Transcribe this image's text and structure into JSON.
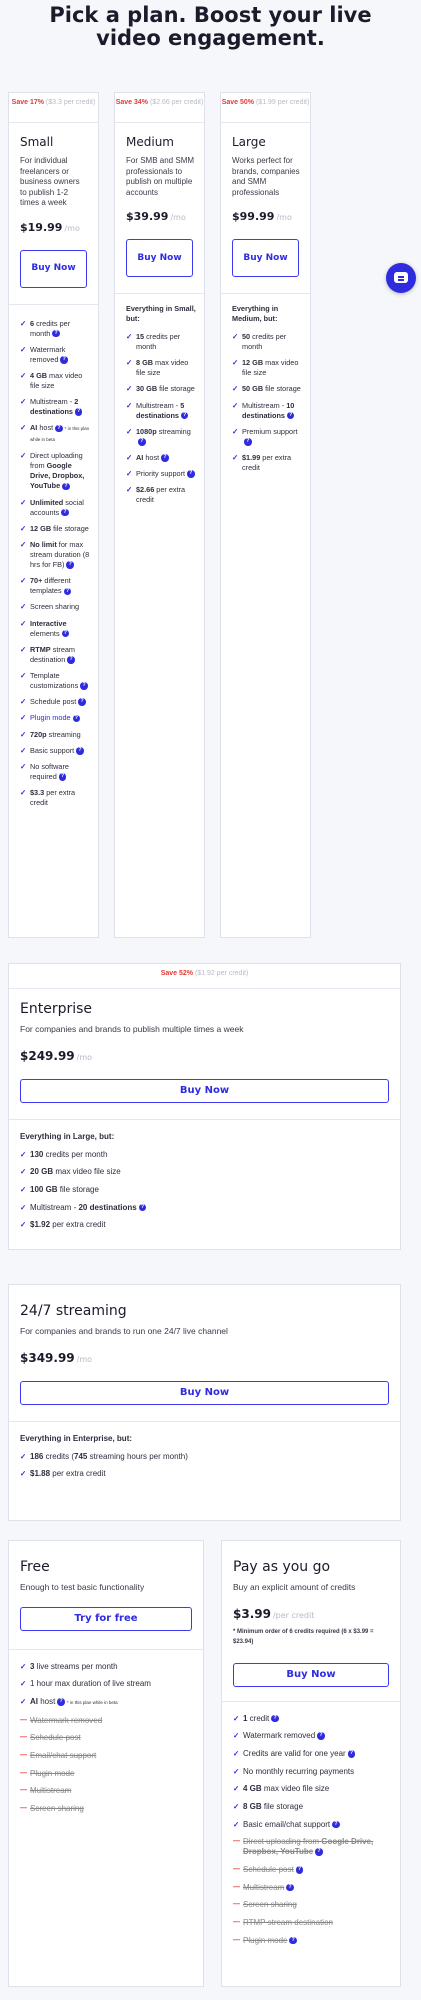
{
  "hero_title": "Pick a plan. Boost your live video engagement.",
  "plans": [
    {
      "id": "small",
      "save_pct": "Save 17%",
      "save_note": "($3.3 per credit)",
      "title": "Small",
      "desc": "For individual freelancers or business owners to publish 1-2 times a week",
      "price": "$19.99",
      "per": "/mo",
      "button": "Buy Now",
      "lead": "",
      "features": [
        {
          "bold": "6",
          "text": " credits per month",
          "help": true
        },
        {
          "text": "Watermark removed",
          "help": true
        },
        {
          "bold": "4 GB",
          "text": " max video file size"
        },
        {
          "text": "Multistream - ",
          "bold2": "2 destinations",
          "help": true
        },
        {
          "bold": "AI",
          "text": " host",
          "help": true,
          "beta": "* in this plan while in beta"
        },
        {
          "text": "Direct uploading from ",
          "bold2": "Google Drive, Dropbox, YouTube",
          "help": true
        },
        {
          "bold": "Unlimited",
          "text": " social accounts",
          "help": true
        },
        {
          "bold": "12 GB",
          "text": " file storage"
        },
        {
          "bold": "No limit",
          "text": " for max stream duration (8 hrs for FB)",
          "help": true
        },
        {
          "bold": "70+",
          "text": " different templates",
          "help": true
        },
        {
          "text": "Screen sharing"
        },
        {
          "bold": "Interactive",
          "text": " elements",
          "help": true
        },
        {
          "bold": "RTMP",
          "text": " stream destination",
          "help": true
        },
        {
          "text": "Template customizations",
          "help": true
        },
        {
          "text": "Schedule post",
          "help": true
        },
        {
          "text": "Plugin mode",
          "help": true,
          "plugin": true
        },
        {
          "bold": "720p",
          "text": " streaming"
        },
        {
          "text": "Basic support",
          "help": true
        },
        {
          "text": "No software required",
          "help": true
        },
        {
          "bold": "$3.3",
          "text": " per extra credit"
        }
      ]
    },
    {
      "id": "medium",
      "save_pct": "Save 34%",
      "save_note": "($2.66 per credit)",
      "title": "Medium",
      "desc": "For SMB and SMM professionals to publish on multiple accounts",
      "price": "$39.99",
      "per": "/mo",
      "button": "Buy Now",
      "lead": "Everything in Small, but:",
      "features": [
        {
          "bold": "15",
          "text": " credits per month"
        },
        {
          "bold": "8 GB",
          "text": " max video file size"
        },
        {
          "bold": "30 GB",
          "text": " file storage"
        },
        {
          "text": "Multistream - ",
          "bold2": "5 destinations",
          "help": true
        },
        {
          "bold": "1080p",
          "text": " streaming",
          "help": true
        },
        {
          "bold": "AI",
          "text": " host",
          "help": true
        },
        {
          "text": "Priority support",
          "help": true
        },
        {
          "bold": "$2.66",
          "text": " per extra credit"
        }
      ]
    },
    {
      "id": "large",
      "save_pct": "Save 50%",
      "save_note": "($1.99 per credit)",
      "title": "Large",
      "desc": "Works perfect for brands, companies and SMM professionals",
      "price": "$99.99",
      "per": "/mo",
      "button": "Buy Now",
      "lead": "Everything in Medium, but:",
      "features": [
        {
          "bold": "50",
          "text": " credits per month"
        },
        {
          "bold": "12 GB",
          "text": " max video file size"
        },
        {
          "bold": "50 GB",
          "text": " file storage"
        },
        {
          "text": "Multistream - ",
          "bold2": "10 destinations",
          "help": true
        },
        {
          "text": "Premium support",
          "help": true
        },
        {
          "bold": "$1.99",
          "text": " per extra credit"
        }
      ]
    }
  ],
  "enterprise": {
    "save_pct": "Save 52%",
    "save_note": "($1.92 per credit)",
    "title": "Enterprise",
    "desc": "For companies and brands to publish multiple times a week",
    "price": "$249.99",
    "per": "/mo",
    "button": "Buy Now",
    "lead": "Everything in Large, but:",
    "features": [
      {
        "bold": "130",
        "text": " credits per month"
      },
      {
        "bold": "20 GB",
        "text": " max video file size"
      },
      {
        "bold": "100 GB",
        "text": " file storage"
      },
      {
        "text": "Multistream - ",
        "bold2": "20 destinations",
        "help": true
      },
      {
        "bold": "$1.92",
        "text": " per extra credit"
      }
    ]
  },
  "streaming": {
    "title": "24/7 streaming",
    "desc": "For companies and brands to run one 24/7 live channel",
    "price": "$349.99",
    "per": "/mo",
    "button": "Buy Now",
    "lead": "Everything in Enterprise, but:",
    "features": [
      {
        "bold": "186",
        "text": " credits (",
        "bold2": "745",
        "text2": " streaming hours per month)"
      },
      {
        "bold": "$1.88",
        "text": " per extra credit"
      }
    ]
  },
  "free": {
    "title": "Free",
    "desc": "Enough to test basic functionality",
    "button": "Try for free",
    "features": [
      {
        "bold": "3",
        "text": " live streams per month"
      },
      {
        "text": "1 hour max duration of live stream"
      },
      {
        "bold": "AI",
        "text": " host",
        "help": true,
        "beta": "* in this plan while in beta"
      },
      {
        "text": "Watermark removed",
        "no": true
      },
      {
        "text": "Schedule post",
        "no": true
      },
      {
        "text": "Email/chat support",
        "no": true
      },
      {
        "text": "Plugin mode",
        "no": true
      },
      {
        "text": "Multistream",
        "no": true
      },
      {
        "text": "Screen sharing",
        "no": true
      }
    ]
  },
  "payg": {
    "title": "Pay as you go",
    "desc": "Buy an explicit amount of credits",
    "price": "$3.99",
    "per": "/per credit",
    "min_note": "* Minimum order of 6 credits required (6 x $3.99 = $23.94)",
    "button": "Buy Now",
    "features": [
      {
        "bold": "1",
        "text": " credit",
        "help": true
      },
      {
        "text": "Watermark removed",
        "help": true
      },
      {
        "text": "Credits are valid for one year",
        "help": true
      },
      {
        "text": "No monthly recurring payments"
      },
      {
        "bold": "4 GB",
        "text": " max video file size"
      },
      {
        "bold": "8 GB",
        "text": " file storage"
      },
      {
        "text": "Basic email/chat support",
        "help": true
      },
      {
        "text": "Direct uploading from ",
        "bold2": "Google Drive, Dropbox, YouTube",
        "help": true,
        "no": true
      },
      {
        "text": "Schedule post",
        "help": true,
        "no": true
      },
      {
        "text": "Multistream",
        "help": true,
        "no": true
      },
      {
        "text": "Screen sharing",
        "no": true
      },
      {
        "text": "RTMP stream destination",
        "no": true
      },
      {
        "text": "Plugin mode",
        "help": true,
        "no": true
      }
    ]
  },
  "colors": {
    "accent": "#2f2ce0",
    "save_red": "#e53935",
    "background": "#f6f7fb"
  },
  "icons": {
    "check": "check-icon",
    "help": "help-icon",
    "unavailable": "dash-icon",
    "chat": "chat-bubble-icon"
  }
}
